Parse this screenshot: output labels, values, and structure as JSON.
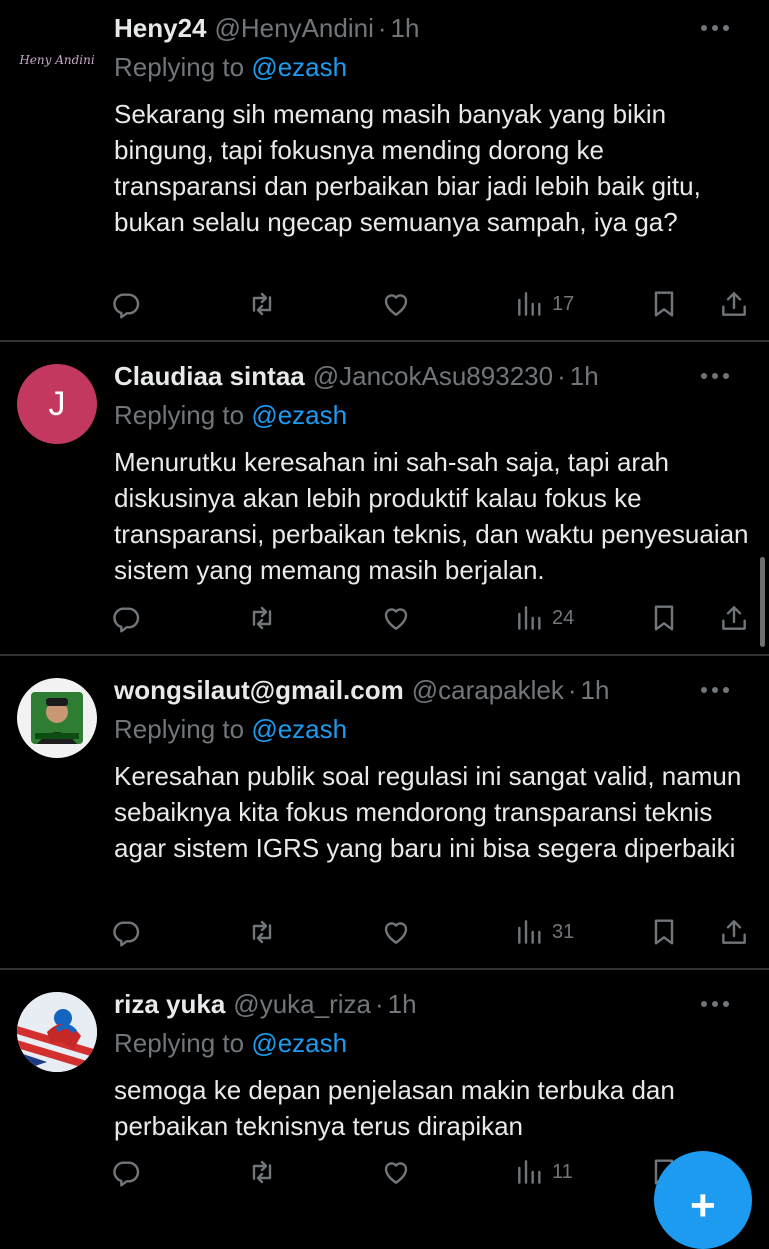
{
  "tweets": [
    {
      "name": "Heny24",
      "handle": "@HenyAndini",
      "time": "1h",
      "replying_prefix": "Replying to",
      "replying_to": "@ezash",
      "text": "Sekarang sih memang masih banyak yang bikin bingung, tapi fokusnya mending  dorong ke transparansi dan perbaikan biar jadi lebih baik gitu, bukan selalu ngecap semuanya sampah, iya ga?",
      "avatar_text": "Heny Andini",
      "views": "17"
    },
    {
      "name": "Claudiaa sintaa",
      "handle": "@JancokAsu893230",
      "time": "1h",
      "replying_prefix": "Replying to",
      "replying_to": "@ezash",
      "text": "Menurutku keresahan ini sah-sah saja, tapi arah diskusinya akan lebih produktif kalau fokus ke transparansi, perbaikan teknis, dan waktu penyesuaian sistem yang memang masih berjalan.",
      "avatar_letter": "J",
      "avatar_color": "#c2385f",
      "views": "24"
    },
    {
      "name": "wongsilaut@gmail.com",
      "handle": "@carapaklek",
      "time": "1h",
      "replying_prefix": "Replying to",
      "replying_to": "@ezash",
      "text": "Keresahan publik soal regulasi ini sangat valid, namun sebaiknya kita fokus mendorong transparansi teknis agar sistem IGRS yang baru ini bisa segera diperbaiki",
      "views": "31"
    },
    {
      "name": "riza yuka",
      "handle": "@yuka_riza",
      "time": "1h",
      "replying_prefix": "Replying to",
      "replying_to": "@ezash",
      "text": "semoga ke depan penjelasan makin terbuka dan perbaikan teknisnya terus dirapikan",
      "views": "11"
    }
  ],
  "sep": "·",
  "compose_icon": "+",
  "colors": {
    "accent": "#1d9bf0",
    "muted": "#71767b",
    "divider": "#2f3336"
  }
}
